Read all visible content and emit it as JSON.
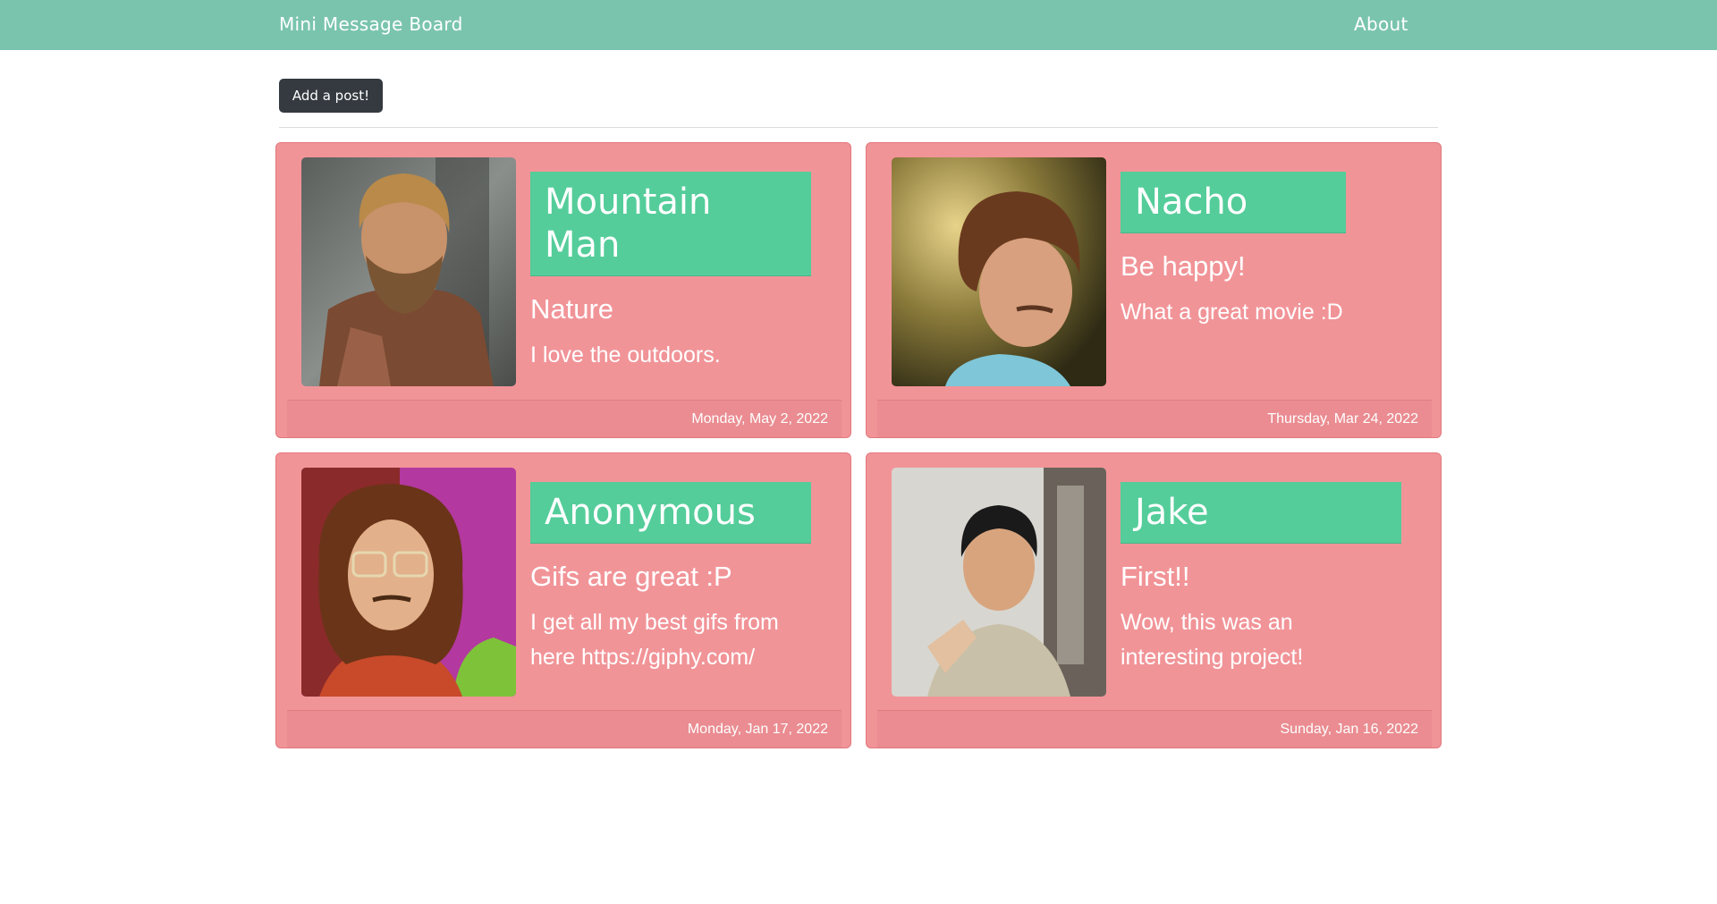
{
  "navbar": {
    "brand": "Mini Message Board",
    "about": "About"
  },
  "actions": {
    "add_post_label": "Add a post!"
  },
  "posts": [
    {
      "author": "Mountain Man",
      "subject": "Nature",
      "body": "I love the outdoors.",
      "date": "Monday, May 2, 2022",
      "image_icon": "bearded-man-photo"
    },
    {
      "author": "Nacho",
      "subject": "Be happy!",
      "body": "What a great movie :D",
      "date": "Thursday, Mar 24, 2022",
      "image_icon": "curly-hair-man-photo"
    },
    {
      "author": "Anonymous",
      "subject": "Gifs are great :P",
      "body": "I get all my best gifs from here https://giphy.com/",
      "date": "Monday, Jan 17, 2022",
      "image_icon": "glasses-man-photo"
    },
    {
      "author": "Jake",
      "subject": "First!!",
      "body": "Wow, this was an interesting project!",
      "date": "Sunday, Jan 16, 2022",
      "image_icon": "smoking-man-photo"
    }
  ],
  "colors": {
    "navbar": "#7ac4ae",
    "card": "#f19498",
    "title_bg": "#54cd9a",
    "button": "#343a40"
  }
}
